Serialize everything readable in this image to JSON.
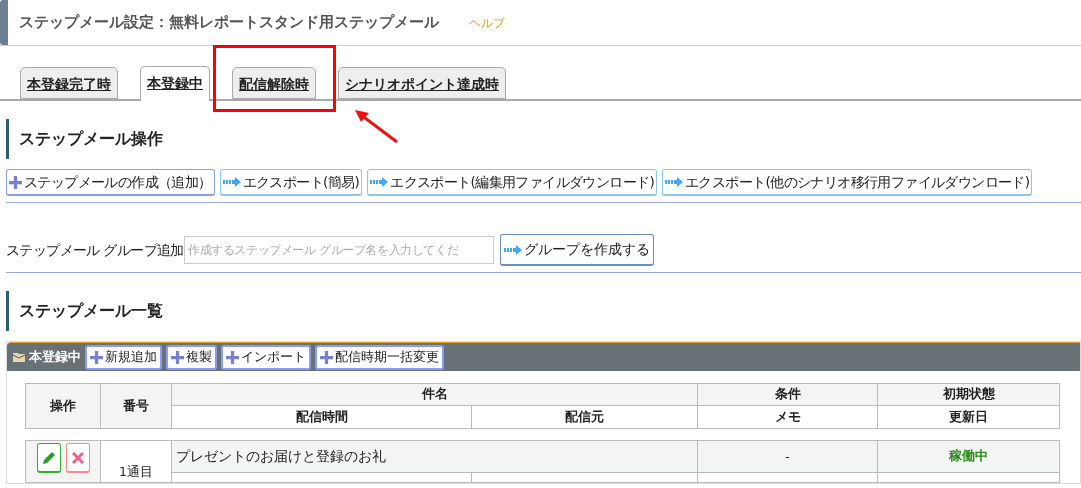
{
  "header": {
    "title": "ステップメール設定：無料レポートスタンド用ステップメール",
    "help": "ヘルプ"
  },
  "tabs": [
    {
      "label": "本登録完了時",
      "selected": false
    },
    {
      "label": "本登録中",
      "selected": true
    },
    {
      "label": "配信解除時",
      "selected": false,
      "highlighted": true
    },
    {
      "label": "シナリオポイント達成時",
      "selected": false
    }
  ],
  "operations": {
    "heading": "ステップメール操作",
    "buttons": [
      {
        "kind": "plus",
        "label": "ステップメールの作成（追加）"
      },
      {
        "kind": "arrow",
        "label": "エクスポート(簡易)"
      },
      {
        "kind": "arrow",
        "label": "エクスポート(編集用ファイルダウンロード)"
      },
      {
        "kind": "arrow",
        "label": "エクスポート(他のシナリオ移行用ファイルダウンロード)"
      }
    ]
  },
  "group_add": {
    "label": "ステップメール グループ追加",
    "placeholder": "作成するステップメール グループ名を入力してくだ",
    "button": "グループを作成する"
  },
  "list": {
    "heading": "ステップメール一覧",
    "group": {
      "name": "本登録中",
      "buttons": [
        "新規追加",
        "複製",
        "インポート",
        "配信時期一括変更"
      ]
    },
    "columns": {
      "ops": "操作",
      "number": "番号",
      "subject": "件名",
      "send_time": "配信時間",
      "sender": "配信元",
      "condition": "条件",
      "memo": "メモ",
      "initial_state": "初期状態",
      "updated": "更新日"
    },
    "rows": [
      {
        "number": "1通目",
        "subject": "プレゼントのお届けと登録のお礼",
        "condition": "-",
        "state": "稼働中",
        "active": true
      }
    ]
  }
}
